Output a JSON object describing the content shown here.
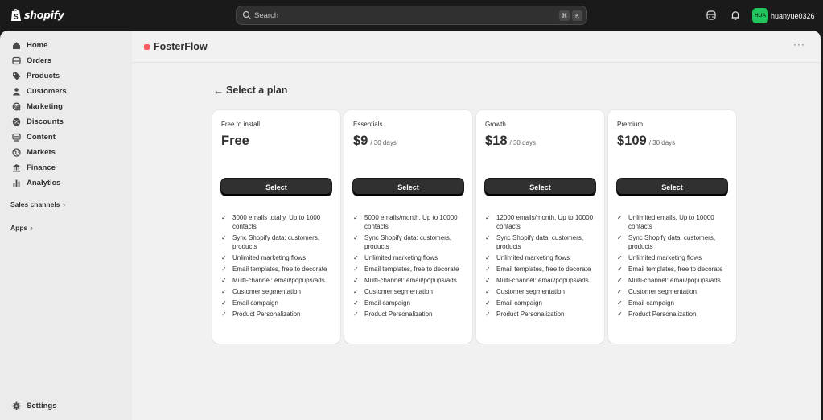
{
  "topbar": {
    "brand": "shopify",
    "search_placeholder": "Search",
    "shortcut_cmd": "⌘",
    "shortcut_key": "K",
    "avatar_initials": "HUA",
    "username": "huanyue0326"
  },
  "sidebar": {
    "items": [
      {
        "label": "Home",
        "icon": "home-icon"
      },
      {
        "label": "Orders",
        "icon": "inbox-icon"
      },
      {
        "label": "Products",
        "icon": "tag-icon"
      },
      {
        "label": "Customers",
        "icon": "person-icon"
      },
      {
        "label": "Marketing",
        "icon": "target-icon"
      },
      {
        "label": "Discounts",
        "icon": "discount-icon"
      },
      {
        "label": "Content",
        "icon": "content-icon"
      },
      {
        "label": "Markets",
        "icon": "globe-icon"
      },
      {
        "label": "Finance",
        "icon": "bank-icon"
      },
      {
        "label": "Analytics",
        "icon": "chart-icon"
      }
    ],
    "sales_channels": "Sales channels",
    "apps": "Apps",
    "settings": "Settings"
  },
  "app": {
    "title": "FosterFlow",
    "more": "···"
  },
  "page": {
    "title": "Select a plan"
  },
  "plans": [
    {
      "name": "Free to install",
      "price": "Free",
      "period": "",
      "button": "Select",
      "features": [
        "3000 emails totally, Up to 1000 contacts",
        "Sync Shopify data: customers, products",
        "Unlimited marketing flows",
        "Email templates, free to decorate",
        "Multi-channel: email/popups/ads",
        "Customer segmentation",
        "Email campaign",
        "Product Personalization"
      ]
    },
    {
      "name": "Essentials",
      "price": "$9",
      "period": "/ 30 days",
      "button": "Select",
      "features": [
        "5000 emails/month, Up to 10000 contacts",
        "Sync Shopify data: customers, products",
        "Unlimited marketing flows",
        "Email templates, free to decorate",
        "Multi-channel: email/popups/ads",
        "Customer segmentation",
        "Email campaign",
        "Product Personalization"
      ]
    },
    {
      "name": "Growth",
      "price": "$18",
      "period": "/ 30 days",
      "button": "Select",
      "features": [
        "12000 emails/month, Up to 10000 contacts",
        "Sync Shopify data: customers, products",
        "Unlimited marketing flows",
        "Email templates, free to decorate",
        "Multi-channel: email/popups/ads",
        "Customer segmentation",
        "Email campaign",
        "Product Personalization"
      ]
    },
    {
      "name": "Premium",
      "price": "$109",
      "period": "/ 30 days",
      "button": "Select",
      "features": [
        "Unlimited emails, Up to 10000 contacts",
        "Sync Shopify data: customers, products",
        "Unlimited marketing flows",
        "Email templates, free to decorate",
        "Multi-channel: email/popups/ads",
        "Customer segmentation",
        "Email campaign",
        "Product Personalization"
      ]
    }
  ],
  "colors": {
    "topbar_bg": "#1a1a1a",
    "sidebar_bg": "#ebebeb",
    "main_bg": "#f1f1f1",
    "button_bg": "#303030",
    "avatar_bg": "#22c55e",
    "app_icon": "#ff5a5f"
  }
}
